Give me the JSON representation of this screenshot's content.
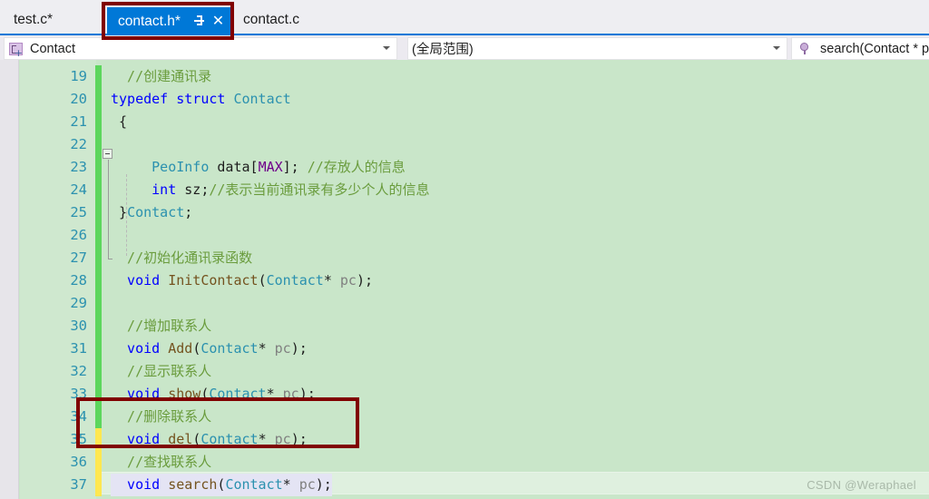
{
  "window": {
    "accent_color": "#0078d7",
    "annotation_color": "#800000",
    "editor_background": "#c9e6c9"
  },
  "tabs": [
    {
      "label": "test.c*",
      "active": false
    },
    {
      "label": "contact.h*",
      "active": true,
      "pin_icon": "pin-icon",
      "close_icon": "close-icon",
      "close_glyph": "✕"
    },
    {
      "label": "contact.c",
      "active": false
    }
  ],
  "navbar": {
    "scope": {
      "icon": "struct-icon",
      "value": "Contact"
    },
    "member": {
      "value": "(全局范围)"
    },
    "function": {
      "icon": "method-icon",
      "value": "search(Contact * p"
    }
  },
  "editor": {
    "language": "c",
    "lines": [
      {
        "no": "19",
        "marker": "green",
        "tokens": [
          {
            "t": "  //创建通讯录",
            "c": "cmt"
          }
        ]
      },
      {
        "no": "20",
        "marker": "green",
        "tokens": [
          {
            "t": "typedef ",
            "c": "kw"
          },
          {
            "t": "struct ",
            "c": "kw"
          },
          {
            "t": "Contact",
            "c": "typ"
          }
        ]
      },
      {
        "no": "21",
        "marker": "green",
        "tokens": [
          {
            "t": " {",
            "c": "pl"
          }
        ]
      },
      {
        "no": "22",
        "marker": "green",
        "tokens": [
          {
            "t": "",
            "c": "pl"
          }
        ]
      },
      {
        "no": "23",
        "marker": "green",
        "tokens": [
          {
            "t": "     PeoInfo",
            "c": "typ"
          },
          {
            "t": " data[",
            "c": "pl"
          },
          {
            "t": "MAX",
            "c": "macro"
          },
          {
            "t": "]; ",
            "c": "pl"
          },
          {
            "t": "//存放人的信息",
            "c": "cmt"
          }
        ]
      },
      {
        "no": "24",
        "marker": "green",
        "tokens": [
          {
            "t": "     int",
            "c": "kw"
          },
          {
            "t": " sz;",
            "c": "pl"
          },
          {
            "t": "//表示当前通讯录有多少个人的信息",
            "c": "cmt"
          }
        ]
      },
      {
        "no": "25",
        "marker": "green",
        "tokens": [
          {
            "t": " }",
            "c": "pl"
          },
          {
            "t": "Contact",
            "c": "typ"
          },
          {
            "t": ";",
            "c": "pl"
          }
        ]
      },
      {
        "no": "26",
        "marker": "green",
        "tokens": [
          {
            "t": "",
            "c": "pl"
          }
        ]
      },
      {
        "no": "27",
        "marker": "green",
        "tokens": [
          {
            "t": "  //初始化通讯录函数",
            "c": "cmt"
          }
        ]
      },
      {
        "no": "28",
        "marker": "green",
        "tokens": [
          {
            "t": "  void ",
            "c": "kw"
          },
          {
            "t": "InitContact",
            "c": "fn"
          },
          {
            "t": "(",
            "c": "pl"
          },
          {
            "t": "Contact",
            "c": "typ"
          },
          {
            "t": "* ",
            "c": "pl"
          },
          {
            "t": "pc",
            "c": "param"
          },
          {
            "t": ");",
            "c": "pl"
          }
        ]
      },
      {
        "no": "29",
        "marker": "green",
        "tokens": [
          {
            "t": "",
            "c": "pl"
          }
        ]
      },
      {
        "no": "30",
        "marker": "green",
        "tokens": [
          {
            "t": "  //增加联系人",
            "c": "cmt"
          }
        ]
      },
      {
        "no": "31",
        "marker": "green",
        "tokens": [
          {
            "t": "  void ",
            "c": "kw"
          },
          {
            "t": "Add",
            "c": "fn"
          },
          {
            "t": "(",
            "c": "pl"
          },
          {
            "t": "Contact",
            "c": "typ"
          },
          {
            "t": "* ",
            "c": "pl"
          },
          {
            "t": "pc",
            "c": "param"
          },
          {
            "t": ");",
            "c": "pl"
          }
        ]
      },
      {
        "no": "32",
        "marker": "green",
        "tokens": [
          {
            "t": "  //显示联系人",
            "c": "cmt"
          }
        ]
      },
      {
        "no": "33",
        "marker": "green",
        "tokens": [
          {
            "t": "  void ",
            "c": "kw"
          },
          {
            "t": "show",
            "c": "fn"
          },
          {
            "t": "(",
            "c": "pl"
          },
          {
            "t": "Contact",
            "c": "typ"
          },
          {
            "t": "* ",
            "c": "pl"
          },
          {
            "t": "pc",
            "c": "param"
          },
          {
            "t": ");",
            "c": "pl"
          }
        ]
      },
      {
        "no": "34",
        "marker": "green",
        "tokens": [
          {
            "t": "  //删除联系人",
            "c": "cmt"
          }
        ]
      },
      {
        "no": "35",
        "marker": "yellow",
        "tokens": [
          {
            "t": "  void ",
            "c": "kw"
          },
          {
            "t": "del",
            "c": "fn"
          },
          {
            "t": "(",
            "c": "pl"
          },
          {
            "t": "Contact",
            "c": "typ"
          },
          {
            "t": "* ",
            "c": "pl"
          },
          {
            "t": "pc",
            "c": "param"
          },
          {
            "t": ");",
            "c": "pl"
          }
        ]
      },
      {
        "no": "36",
        "marker": "yellow",
        "tokens": [
          {
            "t": "  //查找联系人",
            "c": "cmt"
          }
        ]
      },
      {
        "no": "37",
        "marker": "yellow",
        "current": true,
        "tokens": [
          {
            "t": "  void ",
            "c": "kw"
          },
          {
            "t": "search",
            "c": "fn"
          },
          {
            "t": "(",
            "c": "pl"
          },
          {
            "t": "Contact",
            "c": "typ"
          },
          {
            "t": "* ",
            "c": "pl"
          },
          {
            "t": "pc",
            "c": "param"
          },
          {
            "t": ");",
            "c": "pl"
          }
        ]
      }
    ]
  },
  "watermark": {
    "text": "CSDN @Weraphael"
  }
}
